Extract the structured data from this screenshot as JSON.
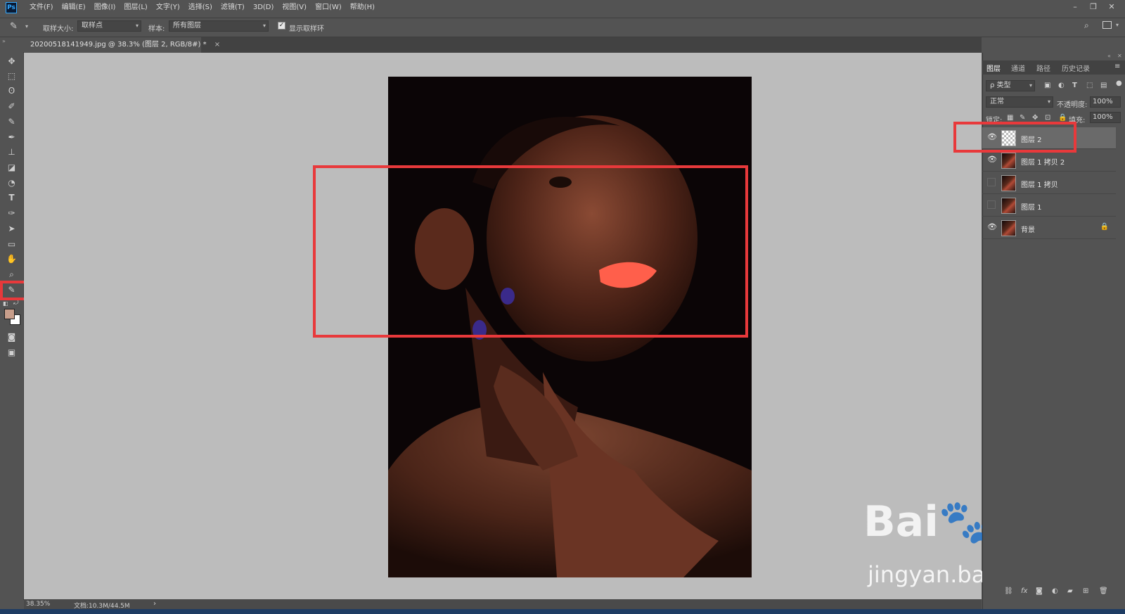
{
  "app": {
    "logo": "Ps"
  },
  "menu": [
    "文件(F)",
    "编辑(E)",
    "图像(I)",
    "图层(L)",
    "文字(Y)",
    "选择(S)",
    "滤镜(T)",
    "3D(D)",
    "视图(V)",
    "窗口(W)",
    "帮助(H)"
  ],
  "options": {
    "sample_size_label": "取样大小:",
    "sample_size_value": "取样点",
    "sample_label": "样本:",
    "sample_value": "所有图层",
    "show_ring_label": "显示取样环",
    "show_ring_checked": true
  },
  "document": {
    "tab_title": "20200518141949.jpg @ 38.3% (图层 2, RGB/8#) *",
    "close_glyph": "×"
  },
  "tools": [
    "move-tool",
    "marquee-tool",
    "lasso-tool",
    "quick-select-tool",
    "spot-healing-tool",
    "brush-tool",
    "clone-stamp-tool",
    "eraser-tool",
    "dodge-tool",
    "type-tool",
    "pen-tool",
    "path-select-tool",
    "shape-tool",
    "hand-tool",
    "zoom-tool",
    "eyedropper-tool"
  ],
  "colors": {
    "foreground": "#c89e8b",
    "background": "#ffffff",
    "annotation": "#e8393b",
    "canvas_bg": "#bcbcbc"
  },
  "status": {
    "zoom": "38.35%",
    "doc_size": "文档:10.3M/44.5M",
    "arrow": "›"
  },
  "panel": {
    "tabs": [
      "图层",
      "通道",
      "路径",
      "历史记录"
    ],
    "active_tab": "图层",
    "filter_label": "ρ 类型",
    "blend_mode": "正常",
    "opacity_label": "不透明度:",
    "opacity_value": "100%",
    "lock_label": "锁定:",
    "fill_label": "填充:",
    "fill_value": "100%",
    "layers": [
      {
        "name": "图层 2",
        "visible": true,
        "selected": true,
        "thumb": "transparent"
      },
      {
        "name": "图层 1 拷贝 2",
        "visible": true,
        "selected": false,
        "thumb": "photo"
      },
      {
        "name": "图层 1 拷贝",
        "visible": false,
        "selected": false,
        "thumb": "photo"
      },
      {
        "name": "图层 1",
        "visible": false,
        "selected": false,
        "thumb": "photo"
      },
      {
        "name": "背景",
        "visible": true,
        "selected": false,
        "thumb": "photo",
        "locked": true
      }
    ],
    "footer_icons": [
      "link-icon",
      "fx-icon",
      "mask-icon",
      "adjustment-icon",
      "folder-icon",
      "new-layer-icon",
      "trash-icon"
    ],
    "fx_label": "fx"
  },
  "watermark": {
    "logo": "Bai🐾du 经验",
    "url": "jingyan.baidu.com"
  }
}
